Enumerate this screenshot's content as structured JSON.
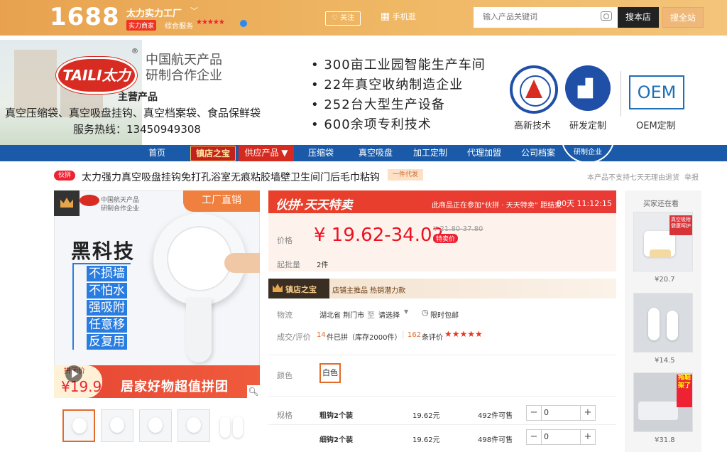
{
  "topbar": {
    "logo": "1688",
    "shop_name": "太力实力工厂",
    "badge": "实力商家",
    "service_label": "综合服务",
    "stars": "★★★★★",
    "follow": "关注",
    "mobile": "手机逛",
    "search_placeholder": "输入产品关键词",
    "search_shop": "搜本店",
    "search_all": "搜全站"
  },
  "banner": {
    "brand": "TAILI太力",
    "reg_mark": "®",
    "aero_line1": "中国航天产品",
    "aero_line2": "研制合作企业",
    "main_products_title": "主营产品",
    "products": "真空压缩袋、真空吸盘挂钩、真空档案袋、食品保鲜袋",
    "hotline": "服务热线：13450949308",
    "bullets": [
      "• 300亩工业园智能生产车间",
      "• 22年真空收纳制造企业",
      "• 252台大型生产设备",
      "• 600余项专利技术"
    ],
    "badge_captions": [
      "高新技术",
      "研发定制",
      "OEM定制"
    ],
    "oem": "OEM"
  },
  "nav": {
    "items": [
      "首页",
      "镇店之宝",
      "供应产品 ▼",
      "压缩袋",
      "真空吸盘",
      "加工定制",
      "代理加盟",
      "公司档案"
    ],
    "stamp": "研制企业"
  },
  "product": {
    "tag": "伙拼",
    "title": "太力强力真空吸盘挂钩免打孔浴室无痕粘胶墙壁卫生间门后毛巾粘钩",
    "dropship": "一件代发",
    "refund_note": "本产品不支持七天无理由退货",
    "report": "举报"
  },
  "gallery": {
    "aero_line1": "中国航天产品",
    "aero_line2": "研制合作企业",
    "factory": "工厂直销",
    "headline": "黑科技",
    "features": [
      "不损墙",
      "不怕水",
      "强吸附",
      "任意移",
      "反复用"
    ],
    "bottom_text": "居家好物超值拼团",
    "pin_label": "拼团价",
    "pin_price": "¥19.9"
  },
  "deal": {
    "logo": "伙拼·天天特卖",
    "note": "此商品正在参加“伙拼 · 天天特卖” 距结束",
    "countdown": "00天 11:12:15",
    "price_label": "价格",
    "price": "¥ 19.62-34.02",
    "old_price": "¥ 21.80-37.80",
    "special": "特卖价",
    "moq_label": "起批量",
    "moq": "2件",
    "treasure": "镇店之宝",
    "treasure_note": "店铺主推品  热销潜力款",
    "logistics_label": "物流",
    "from": "湖北省 荆门市",
    "to_word": "至",
    "select": "请选择",
    "free_ship": "限时包邮",
    "sales_label": "成交/评价",
    "sold_num": "14",
    "sold_text": "件已拼（库存2000件）",
    "review_num": "162",
    "review_text": "条评价",
    "stars": "★★★★★",
    "color_label": "颜色",
    "color_value": "白色",
    "spec_label": "规格",
    "specs": [
      {
        "name": "粗钩2个装",
        "price": "19.62元",
        "stock": "492件可售",
        "qty": "0"
      },
      {
        "name": "细钩2个装",
        "price": "19.62元",
        "stock": "498件可售",
        "qty": "0"
      }
    ]
  },
  "rail": {
    "title": "买家还在看",
    "items": [
      {
        "price": "¥20.7",
        "overlay": "真空吸附 健康呵护"
      },
      {
        "price": "¥14.5",
        "overlay": ""
      },
      {
        "price": "¥31.8",
        "overlay": "拖鞋架了"
      }
    ]
  }
}
